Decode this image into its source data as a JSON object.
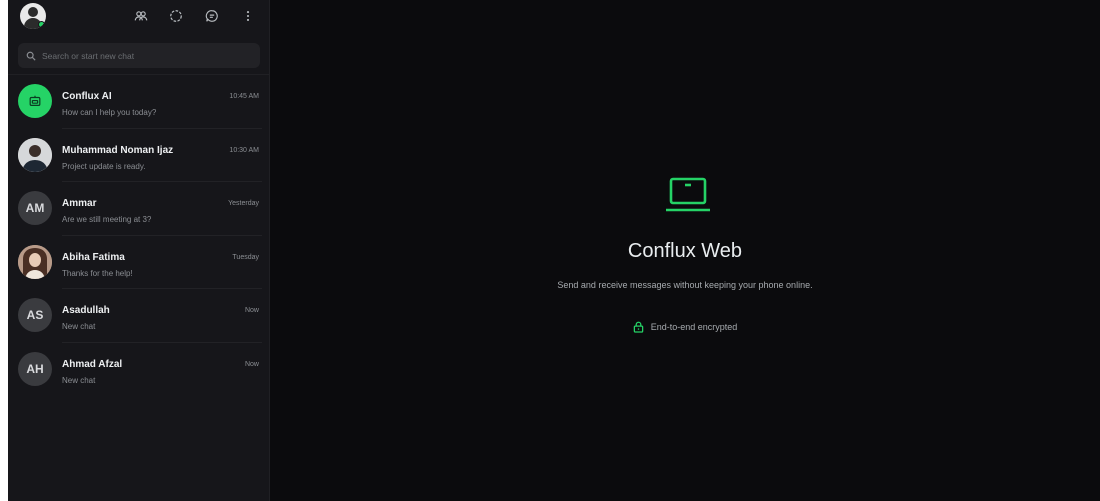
{
  "app": {
    "accent_color": "#25d366"
  },
  "sidebar": {
    "toolbar_icons": [
      "communities-icon",
      "status-icon",
      "new-chat-icon",
      "menu-icon"
    ],
    "search": {
      "placeholder": "Search or start new chat"
    },
    "chats": [
      {
        "name": "Conflux AI",
        "preview": "How can I help you today?",
        "time": "10:45 AM",
        "avatar_type": "ai-icon"
      },
      {
        "name": "Muhammad Noman Ijaz",
        "preview": "Project update is ready.",
        "time": "10:30 AM",
        "avatar_type": "photo"
      },
      {
        "name": "Ammar",
        "preview": "Are we still meeting at 3?",
        "time": "Yesterday",
        "initials": "AM"
      },
      {
        "name": "Abiha Fatima",
        "preview": "Thanks for the help!",
        "time": "Tuesday",
        "avatar_type": "photo"
      },
      {
        "name": "Asadullah",
        "preview": "New chat",
        "time": "Now",
        "initials": "AS"
      },
      {
        "name": "Ahmad Afzal",
        "preview": "New chat",
        "time": "Now",
        "initials": "AH"
      }
    ]
  },
  "main": {
    "icon": "laptop-icon",
    "title": "Conflux Web",
    "subtitle": "Send and receive messages without keeping your phone online.",
    "encryption_label": "End-to-end encrypted",
    "encryption_icon": "lock-icon"
  }
}
